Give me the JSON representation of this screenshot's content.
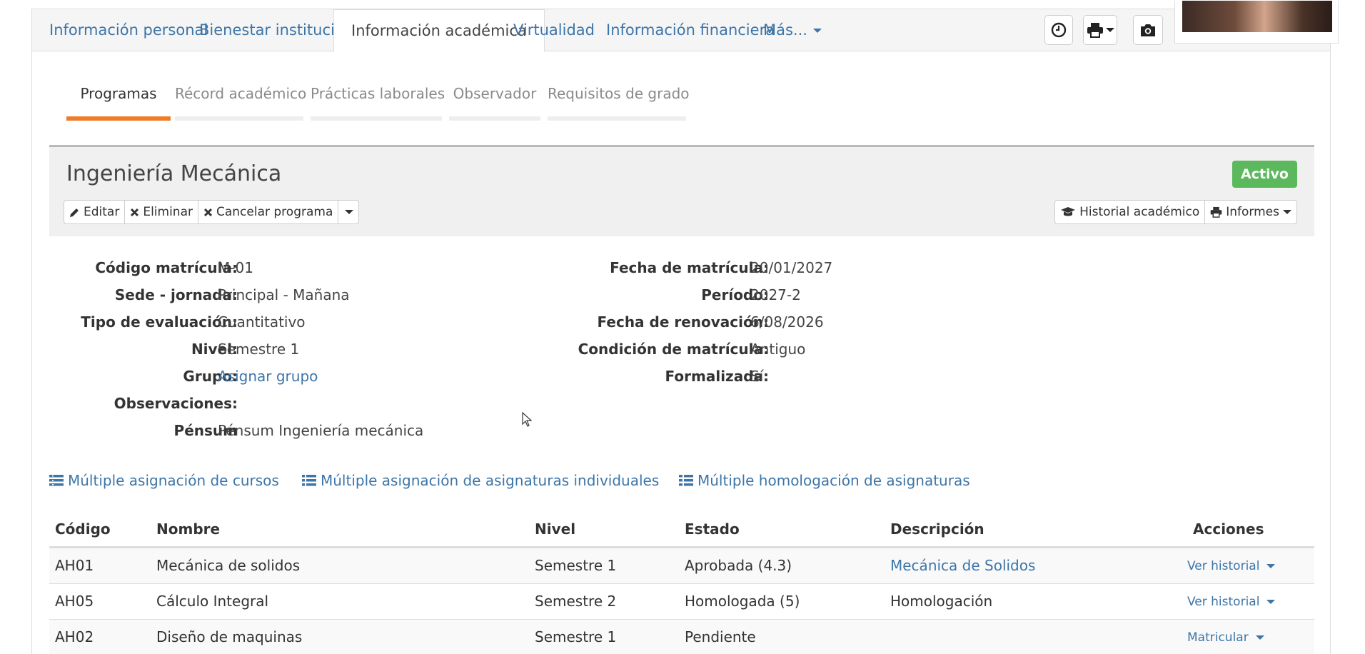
{
  "top_tabs": [
    {
      "label": "Información personal"
    },
    {
      "label": "Bienestar institucional"
    },
    {
      "label": "Información académica"
    },
    {
      "label": "Virtualidad"
    },
    {
      "label": "Información financiera"
    },
    {
      "label": "Más..."
    }
  ],
  "sub_tabs": [
    {
      "label": "Programas"
    },
    {
      "label": "Récord académico"
    },
    {
      "label": "Prácticas laborales"
    },
    {
      "label": "Observador"
    },
    {
      "label": "Requisitos de grado"
    }
  ],
  "program": {
    "title": "Ingeniería Mecánica",
    "status": "Activo",
    "buttons": {
      "edit": "Editar",
      "delete": "Eliminar",
      "cancel": "Cancelar programa"
    },
    "right_buttons": {
      "history": "Historial académico",
      "reports": "Informes"
    }
  },
  "details_left": [
    {
      "label": "Código matrícula:",
      "value": "M-01"
    },
    {
      "label": "Sede - jornada:",
      "value": "Principal - Mañana"
    },
    {
      "label": "Tipo de evaluación:",
      "value": "Cuantitativo"
    },
    {
      "label": "Nivel:",
      "value": "Semestre 1"
    },
    {
      "label": "Grupo:",
      "value": "Asignar grupo"
    },
    {
      "label": "Observaciones:",
      "value": ""
    },
    {
      "label": "Pénsum",
      "value": "Pénsum Ingeniería mecánica"
    }
  ],
  "details_right": [
    {
      "label": "Fecha de matrícula:",
      "value": "20/01/2027"
    },
    {
      "label": "Período:",
      "value": "2027-2"
    },
    {
      "label": "Fecha de renovación:",
      "value": "6/08/2026"
    },
    {
      "label": "Condición de matrícula:",
      "value": "Antiguo"
    },
    {
      "label": "Formalizada:",
      "value": "Sí"
    }
  ],
  "actions": {
    "multi_courses": "Múltiple asignación de cursos",
    "multi_subjects": "Múltiple asignación de asignaturas individuales",
    "multi_homolog": "Múltiple homologación de asignaturas"
  },
  "table": {
    "headers": {
      "code": "Código",
      "name": "Nombre",
      "level": "Nivel",
      "state": "Estado",
      "desc": "Descripción",
      "actions": "Acciones"
    },
    "rows": [
      {
        "code": "AH01",
        "name": "Mecánica de solidos",
        "level": "Semestre 1",
        "state": "Aprobada (4.3)",
        "desc": "Mecánica de Solidos",
        "action": "Ver historial"
      },
      {
        "code": "AH05",
        "name": "Cálculo Integral",
        "level": "Semestre 2",
        "state": "Homologada (5)",
        "desc": "Homologación",
        "action": "Ver historial"
      },
      {
        "code": "AH02",
        "name": "Diseño de maquinas",
        "level": "Semestre 1",
        "state": "Pendiente",
        "desc": "",
        "action": "Matricular"
      }
    ]
  },
  "icons": {
    "clock": "clock-icon",
    "print": "print-icon",
    "camera": "camera-icon",
    "pencil": "pencil-icon",
    "times": "times-icon",
    "graduation": "graduation-cap-icon",
    "list": "list-icon"
  },
  "colors": {
    "accent": "#ee7d29",
    "link": "#3d75a8",
    "success": "#5cb85c"
  }
}
